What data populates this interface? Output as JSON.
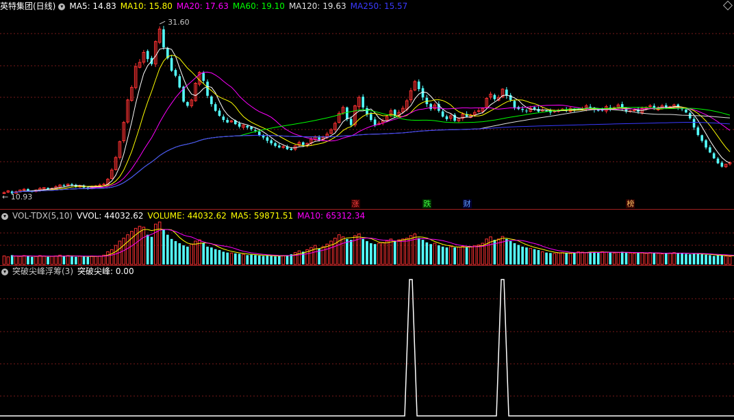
{
  "header": {
    "stock": "英特集团(日线)",
    "ma_items": [
      {
        "label": "MA5: 14.83",
        "color": "#ffffff"
      },
      {
        "label": "MA10: 15.80",
        "color": "#ffff00"
      },
      {
        "label": "MA20: 17.63",
        "color": "#ff00ff"
      },
      {
        "label": "MA60: 19.10",
        "color": "#00ff00"
      },
      {
        "label": "MA120: 19.63",
        "color": "#e0e0e0"
      },
      {
        "label": "MA250: 15.57",
        "color": "#3a3aff"
      }
    ]
  },
  "vol_header": {
    "name": "VOL-TDX(5,10)",
    "items": [
      {
        "label": "VVOL: 44032.62",
        "color": "#ffffff"
      },
      {
        "label": "VOLUME: 44032.62",
        "color": "#ffff00"
      },
      {
        "label": "MA5: 59871.51",
        "color": "#ffff00"
      },
      {
        "label": "MA10: 65312.34",
        "color": "#ff00ff"
      }
    ]
  },
  "ind_header": {
    "name": "突破尖峰浮筹(3)",
    "items": [
      {
        "label": "突破尖峰: 0.00",
        "color": "#ffffff"
      }
    ]
  },
  "markers": [
    {
      "label": "涨",
      "color": "#ff4040",
      "i": 88
    },
    {
      "label": "跌",
      "color": "#40ff40",
      "i": 106
    },
    {
      "label": "财",
      "color": "#60a0ff",
      "i": 116
    },
    {
      "label": "榜",
      "color": "#ffc060",
      "i": 157
    }
  ],
  "chart_data": {
    "type": "candlestick",
    "price_range": [
      10.5,
      33
    ],
    "high_label": "31.60",
    "low_label": "10.93",
    "close": [
      11.4,
      11.6,
      11.3,
      11.5,
      11.7,
      11.8,
      11.6,
      11.5,
      11.7,
      11.9,
      12.0,
      11.8,
      11.9,
      12.1,
      12.3,
      12.2,
      12.4,
      12.3,
      12.1,
      12.2,
      12.0,
      11.9,
      12.1,
      12.2,
      12.3,
      12.4,
      13.0,
      14.1,
      15.6,
      17.5,
      19.8,
      22.5,
      24.0,
      26.5,
      27.0,
      28.2,
      27.4,
      26.8,
      29.5,
      31.0,
      28.8,
      27.5,
      26.0,
      25.4,
      24.0,
      22.3,
      21.8,
      22.5,
      24.5,
      25.8,
      24.8,
      23.0,
      22.0,
      21.2,
      20.6,
      20.1,
      19.8,
      20.0,
      19.6,
      19.3,
      19.5,
      19.2,
      19.0,
      18.8,
      18.3,
      18.0,
      17.6,
      17.3,
      17.0,
      16.8,
      16.9,
      16.6,
      16.5,
      17.0,
      17.4,
      17.1,
      17.3,
      17.8,
      18.1,
      17.7,
      18.0,
      18.4,
      18.9,
      19.7,
      20.9,
      21.6,
      20.2,
      19.5,
      21.8,
      22.8,
      21.6,
      20.8,
      20.1,
      19.5,
      19.7,
      20.0,
      20.5,
      21.2,
      20.6,
      21.0,
      21.5,
      22.4,
      23.6,
      24.7,
      23.8,
      22.8,
      22.0,
      21.4,
      21.9,
      21.2,
      20.5,
      20.2,
      20.6,
      20.0,
      20.3,
      20.8,
      20.5,
      20.7,
      21.0,
      21.2,
      21.5,
      22.7,
      23.2,
      22.6,
      22.8,
      23.8,
      23.0,
      22.5,
      21.6,
      21.4,
      21.3,
      21.2,
      21.5,
      21.4,
      21.1,
      21.3,
      21.2,
      21.0,
      21.2,
      21.3,
      21.4,
      21.2,
      21.5,
      21.3,
      21.4,
      21.5,
      21.8,
      21.6,
      21.3,
      21.2,
      21.3,
      21.7,
      21.4,
      21.6,
      21.9,
      21.5,
      21.1,
      21.2,
      21.3,
      21.1,
      21.5,
      21.6,
      21.8,
      21.4,
      21.5,
      21.8,
      21.6,
      21.7,
      21.9,
      21.6,
      21.4,
      21.0,
      20.3,
      19.2,
      18.3,
      17.6,
      16.8,
      16.2,
      15.5,
      14.9,
      14.5,
      14.8,
      15.0
    ],
    "volume": [
      0.2,
      0.18,
      0.22,
      0.2,
      0.19,
      0.21,
      0.2,
      0.18,
      0.19,
      0.21,
      0.2,
      0.18,
      0.19,
      0.2,
      0.22,
      0.2,
      0.21,
      0.19,
      0.18,
      0.2,
      0.19,
      0.18,
      0.2,
      0.19,
      0.2,
      0.22,
      0.3,
      0.35,
      0.45,
      0.55,
      0.62,
      0.7,
      0.78,
      0.85,
      0.9,
      0.88,
      0.7,
      0.65,
      0.95,
      1.0,
      0.82,
      0.7,
      0.6,
      0.55,
      0.5,
      0.45,
      0.42,
      0.48,
      0.55,
      0.58,
      0.5,
      0.42,
      0.4,
      0.36,
      0.34,
      0.3,
      0.28,
      0.27,
      0.26,
      0.25,
      0.24,
      0.22,
      0.23,
      0.22,
      0.21,
      0.2,
      0.21,
      0.2,
      0.19,
      0.2,
      0.21,
      0.22,
      0.24,
      0.28,
      0.32,
      0.3,
      0.35,
      0.4,
      0.45,
      0.38,
      0.42,
      0.48,
      0.55,
      0.62,
      0.7,
      0.65,
      0.6,
      0.58,
      0.68,
      0.72,
      0.6,
      0.55,
      0.5,
      0.48,
      0.5,
      0.52,
      0.55,
      0.6,
      0.55,
      0.58,
      0.6,
      0.62,
      0.68,
      0.72,
      0.62,
      0.58,
      0.52,
      0.48,
      0.5,
      0.45,
      0.42,
      0.4,
      0.42,
      0.4,
      0.41,
      0.43,
      0.4,
      0.42,
      0.44,
      0.46,
      0.5,
      0.6,
      0.65,
      0.58,
      0.6,
      0.66,
      0.6,
      0.55,
      0.5,
      0.46,
      0.42,
      0.4,
      0.38,
      0.36,
      0.34,
      0.3,
      0.28,
      0.27,
      0.26,
      0.27,
      0.28,
      0.27,
      0.26,
      0.28,
      0.3,
      0.29,
      0.28,
      0.3,
      0.29,
      0.28,
      0.3,
      0.29,
      0.28,
      0.27,
      0.28,
      0.3,
      0.28,
      0.27,
      0.26,
      0.27,
      0.28,
      0.26,
      0.28,
      0.27,
      0.26,
      0.25,
      0.26,
      0.27,
      0.28,
      0.26,
      0.27,
      0.25,
      0.24,
      0.26,
      0.25,
      0.24,
      0.23,
      0.22,
      0.2,
      0.22,
      0.21,
      0.2,
      0.19,
      0.2,
      0.18,
      0.2
    ],
    "spikes": [
      {
        "i": 102,
        "value": 1
      },
      {
        "i": 125,
        "value": 1
      }
    ]
  }
}
